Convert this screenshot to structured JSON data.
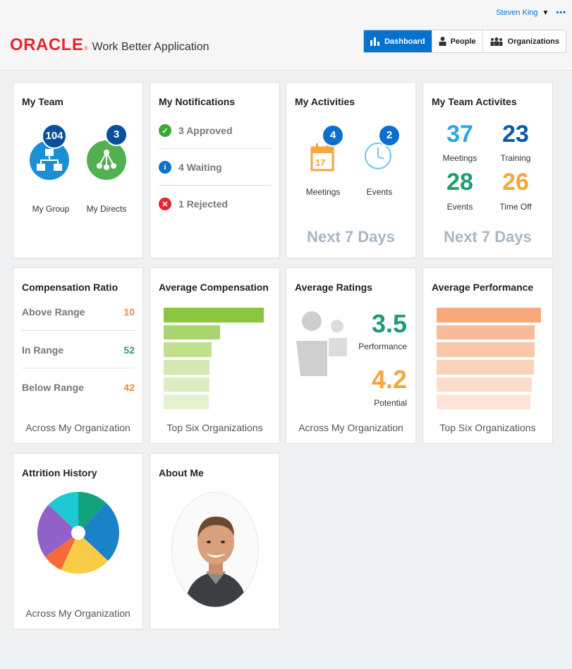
{
  "header": {
    "user_name": "Steven King",
    "more": "•••",
    "brand": "ORACLE",
    "registered": "®",
    "app_name": "Work Better Application",
    "nav": [
      {
        "label": "Dashboard",
        "icon": "bar-chart-icon",
        "active": true
      },
      {
        "label": "People",
        "icon": "person-icon",
        "active": false
      },
      {
        "label": "Organizations",
        "icon": "group-icon",
        "active": false
      }
    ]
  },
  "my_team": {
    "title": "My Team",
    "group": {
      "label": "My Group",
      "count": "104"
    },
    "directs": {
      "label": "My Directs",
      "count": "3"
    }
  },
  "notifications": {
    "title": "My Notifications",
    "items": [
      {
        "count": "3",
        "label": "Approved",
        "icon": "check-icon",
        "color": "#3aa935"
      },
      {
        "count": "4",
        "label": "Waiting",
        "icon": "info-icon",
        "color": "#0572ce"
      },
      {
        "count": "1",
        "label": "Rejected",
        "icon": "x-icon",
        "color": "#e3262e"
      }
    ]
  },
  "activities": {
    "title": "My Activities",
    "meetings": {
      "label": "Meetings",
      "count": "4",
      "calendar_day": "17"
    },
    "events": {
      "label": "Events",
      "count": "2"
    },
    "footer": "Next 7 Days"
  },
  "team_activities": {
    "title": "My Team Activites",
    "items": [
      {
        "value": "37",
        "label": "Meetings",
        "color": "#29a8e0"
      },
      {
        "value": "23",
        "label": "Training",
        "color": "#0a5aa8"
      },
      {
        "value": "28",
        "label": "Events",
        "color": "#1e9e6b"
      },
      {
        "value": "26",
        "label": "Time Off",
        "color": "#f5a63c"
      }
    ],
    "footer": "Next 7 Days"
  },
  "comp_ratio": {
    "title": "Compensation Ratio",
    "rows": [
      {
        "label": "Above Range",
        "value": "10",
        "color": "#f0883a"
      },
      {
        "label": "In Range",
        "value": "52",
        "color": "#2e9e5b"
      },
      {
        "label": "Below Range",
        "value": "42",
        "color": "#f0883a"
      }
    ],
    "footer": "Across My Organization"
  },
  "avg_comp": {
    "title": "Average Compensation",
    "footer": "Top Six Organizations",
    "bars": [
      1.0,
      0.56,
      0.48,
      0.46,
      0.46,
      0.45
    ],
    "colors": [
      "#8cc63f",
      "#a8d56e",
      "#bfe08f",
      "#d3e9b1",
      "#dcedc0",
      "#e5f2d0"
    ]
  },
  "avg_ratings": {
    "title": "Average Ratings",
    "performance": {
      "value": "3.5",
      "label": "Performance",
      "color": "#1e9e6b"
    },
    "potential": {
      "value": "4.2",
      "label": "Potential",
      "color": "#f5a63c"
    },
    "footer": "Across My Organization"
  },
  "avg_perf": {
    "title": "Average Performance",
    "footer": "Top Six Organizations",
    "bars": [
      1.0,
      0.94,
      0.94,
      0.93,
      0.91,
      0.9
    ],
    "colors": [
      "#f8a97c",
      "#f9bb98",
      "#fac7a9",
      "#fbd3bd",
      "#fcdccb",
      "#fde4d6"
    ]
  },
  "attrition": {
    "title": "Attrition History",
    "footer": "Across My Organization",
    "slices": [
      {
        "value": 12,
        "color": "#12a37c"
      },
      {
        "value": 25,
        "color": "#1a83c8"
      },
      {
        "value": 20,
        "color": "#f8cc47"
      },
      {
        "value": 8,
        "color": "#f56a3b"
      },
      {
        "value": 22,
        "color": "#9061c9"
      },
      {
        "value": 13,
        "color": "#1dc9d3"
      }
    ]
  },
  "about_me": {
    "title": "About Me"
  }
}
